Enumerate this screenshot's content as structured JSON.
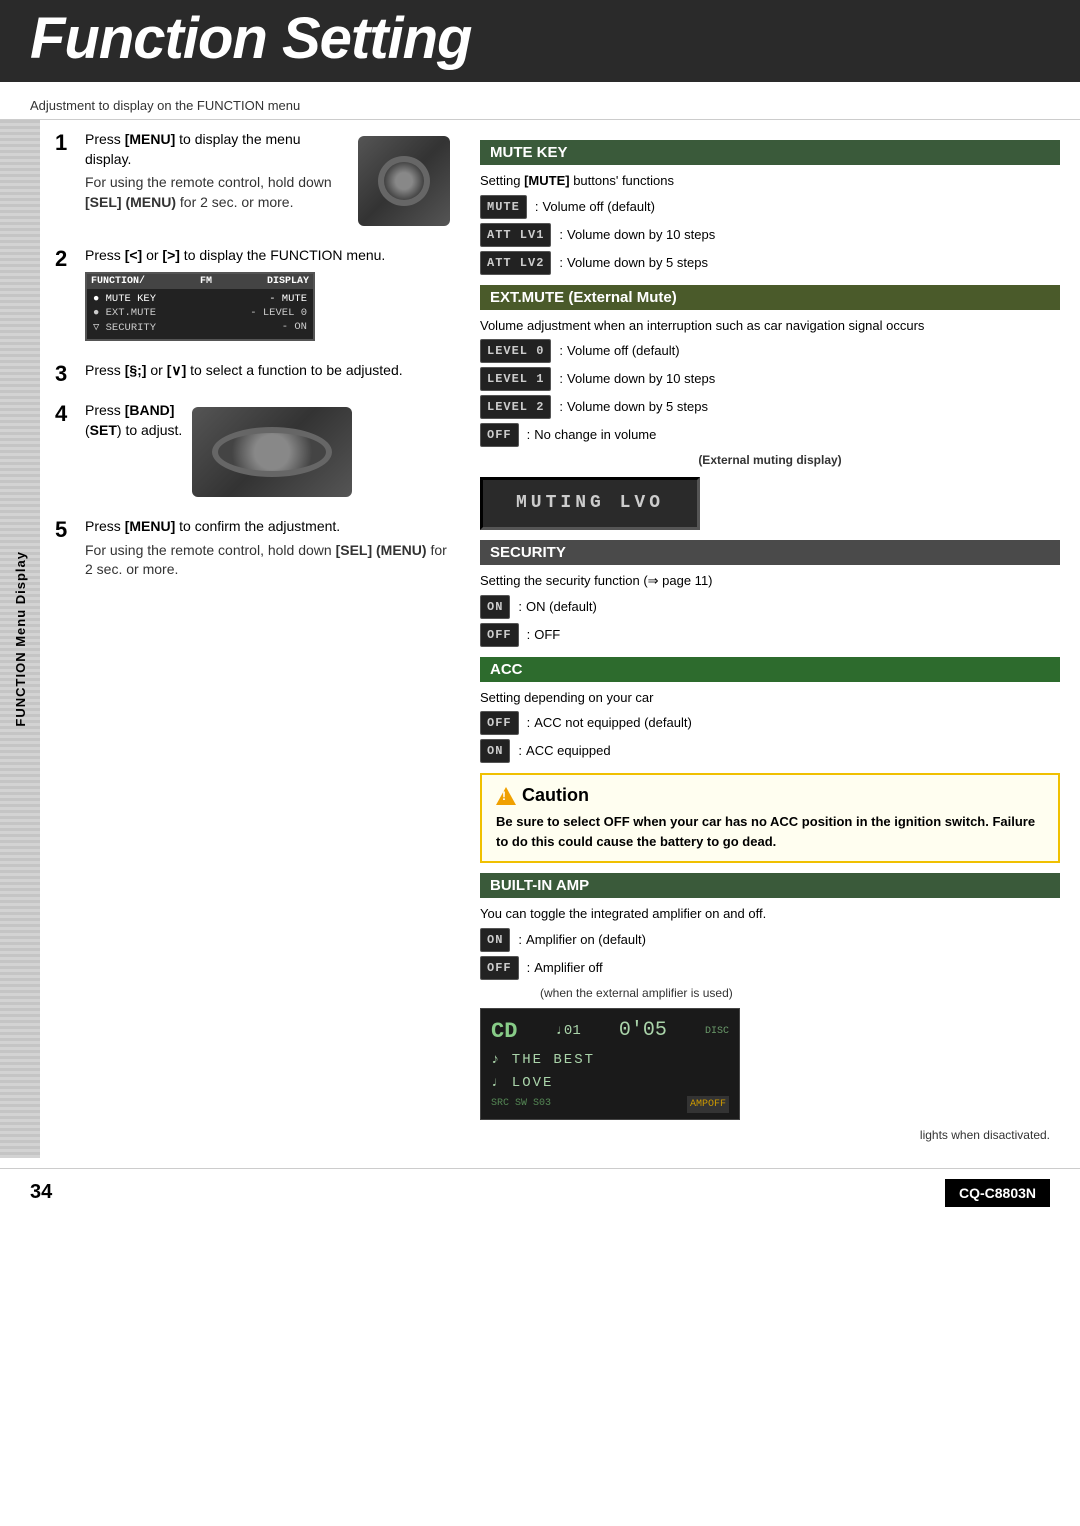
{
  "header": {
    "title": "Function Setting",
    "subtitle": "Adjustment to display on the FUNCTION menu"
  },
  "sidebar": {
    "label": "FUNCTION Menu Display"
  },
  "steps": [
    {
      "num": "1",
      "text": "Press [MENU] to display the menu display.",
      "note": "For using the remote control, hold down [SEL] (MENU) for 2 sec. or more."
    },
    {
      "num": "2",
      "text": "Press [<] or [>] to display the FUNCTION menu."
    },
    {
      "num": "3",
      "text": "Press [∧] or [∨] to select a function to be adjusted."
    },
    {
      "num": "4",
      "text": "Press [BAND] (SET) to adjust."
    },
    {
      "num": "5",
      "text": "Press [MENU] to confirm the adjustment.",
      "note": "For using the remote control, hold down [SEL] (MENU) for 2 sec. or more."
    }
  ],
  "menu_display": {
    "header_cols": [
      "FUNCTION",
      "FM",
      "DISPLAY"
    ],
    "rows": [
      {
        "left": "● MUTE KEY",
        "right": "- MUTE"
      },
      {
        "left": "● EXT.MUTE",
        "right": "- LEVEL 0"
      },
      {
        "left": "▽ SECURITY",
        "right": "- ON"
      }
    ]
  },
  "sections": {
    "mute_key": {
      "header": "MUTE KEY",
      "intro": "Setting [MUTE] buttons' functions",
      "items": [
        {
          "chip": "MUTE",
          "colon": ":",
          "desc": "Volume off (default)"
        },
        {
          "chip": "ATT LV1",
          "colon": ":",
          "desc": "Volume down by 10 steps"
        },
        {
          "chip": "ATT LV2",
          "colon": ":",
          "desc": "Volume down by 5 steps"
        }
      ]
    },
    "ext_mute": {
      "header": "EXT.MUTE (External Mute)",
      "intro": "Volume adjustment when an interruption such as car navigation signal occurs",
      "items": [
        {
          "chip": "LEVEL 0",
          "colon": ":",
          "desc": "Volume off (default)"
        },
        {
          "chip": "LEVEL 1",
          "colon": ":",
          "desc": "Volume down by 10 steps"
        },
        {
          "chip": "LEVEL 2",
          "colon": ":",
          "desc": "Volume down by 5 steps"
        },
        {
          "chip": "OFF",
          "colon": ":",
          "desc": "No change in volume"
        }
      ],
      "muting_label": "(External muting display)",
      "muting_display": "MUTING LVO"
    },
    "security": {
      "header": "SECURITY",
      "intro": "Setting the security function (⇒ page 11)",
      "items": [
        {
          "chip": "ON",
          "colon": ":",
          "desc": "ON (default)"
        },
        {
          "chip": "OFF",
          "colon": ":",
          "desc": "OFF"
        }
      ]
    },
    "acc": {
      "header": "ACC",
      "intro": "Setting depending on your car",
      "items": [
        {
          "chip": "OFF",
          "colon": ":",
          "desc": "ACC not equipped (default)"
        },
        {
          "chip": "ON",
          "colon": ":",
          "desc": "ACC equipped"
        }
      ]
    },
    "built_in_amp": {
      "header": "BUILT-IN AMP",
      "intro": "You can toggle the integrated amplifier on and off.",
      "items": [
        {
          "chip": "ON",
          "colon": ":",
          "desc": "Amplifier on (default)"
        },
        {
          "chip": "OFF",
          "colon": ":",
          "desc": "Amplifier off"
        }
      ],
      "amp_note": "(when the external amplifier is used)",
      "cd_display": {
        "icon": "CD",
        "track": "♩01",
        "time": "0'05",
        "lines": [
          "♪ THE BEST",
          "♩ LOVE"
        ],
        "bottom_left": "SRC SW S03",
        "disc_label": "DISC",
        "ampoff_label": "AMPOFF"
      },
      "lights_note": "lights when disactivated."
    }
  },
  "caution": {
    "title": "Caution",
    "text": "Be sure to select OFF when your car has no ACC position in the ignition switch. Failure to do this could cause the battery to go dead."
  },
  "footer": {
    "page_number": "34",
    "model": "CQ-C8803N"
  }
}
